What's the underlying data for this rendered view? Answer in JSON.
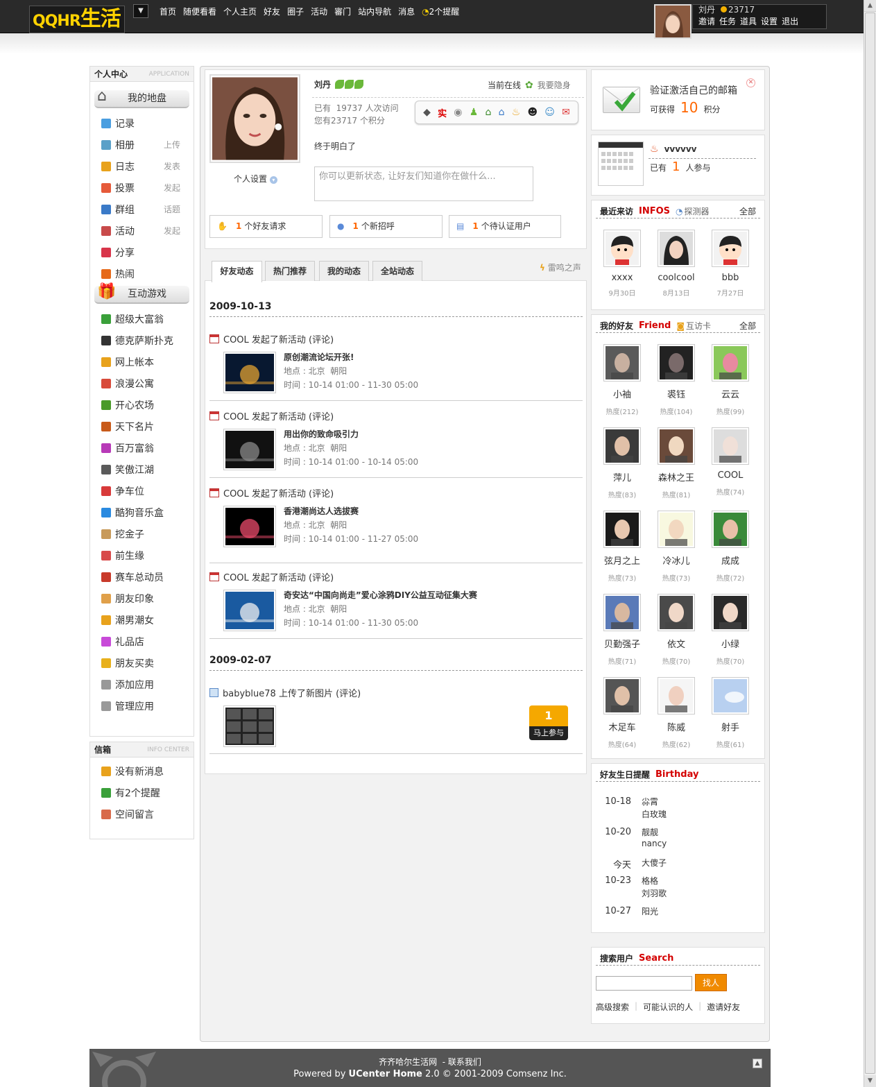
{
  "header": {
    "logo_main": "QQHR",
    "logo_cn": "生活",
    "nav": [
      "首页",
      "随便看看",
      "个人主页",
      "好友",
      "圈子",
      "活动",
      "審门",
      "站内导航",
      "消息",
      "2个提醒"
    ],
    "user_name": "刘丹",
    "user_coins": "23717",
    "user_links": [
      "邀请",
      "任务",
      "道具",
      "设置",
      "退出"
    ]
  },
  "left": {
    "panel_title": "个人中心",
    "panel_title_en": "APPLICATION",
    "section1": "我的地盘",
    "items1": [
      {
        "label": "记录",
        "action": "",
        "color": "#4a9ee0"
      },
      {
        "label": "相册",
        "action": "上传",
        "color": "#5aa0c8"
      },
      {
        "label": "日志",
        "action": "发表",
        "color": "#e8a21c"
      },
      {
        "label": "投票",
        "action": "发起",
        "color": "#e65a3a"
      },
      {
        "label": "群组",
        "action": "话题",
        "color": "#3a7ac8"
      },
      {
        "label": "活动",
        "action": "发起",
        "color": "#c84a4a"
      },
      {
        "label": "分享",
        "action": "",
        "color": "#d8354a"
      },
      {
        "label": "热闹",
        "action": "",
        "color": "#e66a1a"
      }
    ],
    "section2": "互动游戏",
    "items2": [
      {
        "label": "超级大富翁",
        "color": "#3aa03a"
      },
      {
        "label": "德克萨斯扑克",
        "color": "#333333"
      },
      {
        "label": "网上帐本",
        "color": "#e8a21c"
      },
      {
        "label": "浪漫公寓",
        "color": "#d84a3a"
      },
      {
        "label": "开心农场",
        "color": "#4a9a2a"
      },
      {
        "label": "天下名片",
        "color": "#c85a1a"
      },
      {
        "label": "百万富翁",
        "color": "#b83ab8"
      },
      {
        "label": "笑傲江湖",
        "color": "#5a5a5a"
      },
      {
        "label": "争车位",
        "color": "#d83a3a"
      },
      {
        "label": "酷狗音乐盒",
        "color": "#2a8ae0"
      },
      {
        "label": "挖金子",
        "color": "#c89a5a"
      },
      {
        "label": "前生缘",
        "color": "#d84a4a"
      },
      {
        "label": "赛车总动员",
        "color": "#c83a2a"
      },
      {
        "label": "朋友印象",
        "color": "#e0a04a"
      },
      {
        "label": "潮男潮女",
        "color": "#e8a21c"
      },
      {
        "label": "礼品店",
        "color": "#c84ad8"
      },
      {
        "label": "朋友买卖",
        "color": "#e8b01c"
      },
      {
        "label": "添加应用",
        "color": "#999999"
      },
      {
        "label": "管理应用",
        "color": "#999999"
      }
    ],
    "info_title": "信箱",
    "info_title_en": "INFO CENTER",
    "info_items": [
      {
        "label": "没有新消息",
        "color": "#e8a21c"
      },
      {
        "label": "有2个提醒",
        "color": "#3aa03a"
      },
      {
        "label": "空间留言",
        "color": "#d86a4a"
      }
    ]
  },
  "profile": {
    "name": "刘丹",
    "status_online": "当前在线",
    "hide_label": "我要隐身",
    "visits": "已有  19737 人次访问",
    "points": "您有23717 个积分",
    "mood": "终于明白了",
    "settings": "个人设置",
    "status_placeholder": "你可以更新状态, 让好友们知道你在做什么...",
    "notices": [
      {
        "count": "1",
        "label": "个好友请求"
      },
      {
        "count": "1",
        "label": "个新招呼"
      },
      {
        "count": "1",
        "label": "个待认证用户"
      }
    ]
  },
  "tabs": [
    "好友动态",
    "热门推荐",
    "我的动态",
    "全站动态"
  ],
  "tab_right": "雷鸣之声",
  "feeds": {
    "date1": "2009-10-13",
    "date2": "2009-02-07",
    "activities": [
      {
        "head": "COOL 发起了新活动 (评论)",
        "title": "原创潮流论坛开张!",
        "place": "地点 : 北京  朝阳",
        "time": "时间 : 10-14 01:00 - 11-30 05:00"
      },
      {
        "head": "COOL 发起了新活动 (评论)",
        "title": "用出你的致命吸引力",
        "place": "地点 : 北京  朝阳",
        "time": "时间 : 10-14 01:00 - 10-14 05:00"
      },
      {
        "head": "COOL 发起了新活动 (评论)",
        "title": "香港潮尚达人选拔赛",
        "place": "地点 : 北京  朝阳",
        "time": "时间 : 10-14 01:00 - 11-27 05:00"
      },
      {
        "head": "COOL 发起了新活动 (评论)",
        "title": "奇安达“中国向尚走”爱心涂鸦DIY公益互动征集大赛",
        "place": "地点 : 北京  朝阳",
        "time": "时间 : 10-14 01:00 - 11-30 05:00"
      }
    ],
    "upload_head": "babyblue78 上传了新图片 (评论)",
    "join_count": "1",
    "join_label": "马上参与"
  },
  "right": {
    "verify_title": "验证激活自己的邮箱",
    "verify_prefix": "可获得",
    "verify_points": "10",
    "verify_suffix": "积分",
    "event_name": "vvvvvv",
    "event_prefix": "已有",
    "event_count": "1",
    "event_suffix": "人参与",
    "visitors_title": "最近来访",
    "visitors_en": "INFOS",
    "visitors_tool": "探测器",
    "all": "全部",
    "visitors": [
      {
        "name": "xxxx",
        "date": "9月30日"
      },
      {
        "name": "coolcool",
        "date": "8月13日"
      },
      {
        "name": "bbb",
        "date": "7月27日"
      }
    ],
    "friends_title": "我的好友",
    "friends_en": "Friend",
    "friends_tool": "互访卡",
    "friends": [
      {
        "name": "小袖",
        "hot": "热度(212)"
      },
      {
        "name": "裘钰",
        "hot": "热度(104)"
      },
      {
        "name": "云云",
        "hot": "热度(99)"
      },
      {
        "name": "萍儿",
        "hot": "热度(83)"
      },
      {
        "name": "森林之王",
        "hot": "热度(81)"
      },
      {
        "name": "COOL",
        "hot": "热度(74)"
      },
      {
        "name": "弦月之上",
        "hot": "热度(73)"
      },
      {
        "name": "冷冰儿",
        "hot": "热度(73)"
      },
      {
        "name": "成成",
        "hot": "热度(72)"
      },
      {
        "name": "贝勤强子",
        "hot": "热度(71)"
      },
      {
        "name": "依文",
        "hot": "热度(70)"
      },
      {
        "name": "小绿",
        "hot": "热度(70)"
      },
      {
        "name": "木足车",
        "hot": "热度(64)"
      },
      {
        "name": "陈威",
        "hot": "热度(62)"
      },
      {
        "name": "射手",
        "hot": "热度(61)"
      }
    ],
    "birthday_title": "好友生日提醒",
    "birthday_en": "Birthday",
    "birthdays": [
      {
        "date": "10-18",
        "names": [
          "尛霄",
          "白玫瑰"
        ]
      },
      {
        "date": "10-20",
        "names": [
          "靓靓",
          "nancy"
        ]
      },
      {
        "date": "今天",
        "names": [
          "大傻子"
        ]
      },
      {
        "date": "10-23",
        "names": [
          "格格",
          "刘羽歌"
        ]
      },
      {
        "date": "10-27",
        "names": [
          "阳光"
        ]
      }
    ],
    "search_title": "搜索用户",
    "search_en": "Search",
    "search_button": "找人",
    "search_links": [
      "高级搜索",
      "可能认识的人",
      "邀请好友"
    ]
  },
  "footer": {
    "line1": "齐齐哈尔生活网  - 联系我们",
    "line2_prefix": "Powered by ",
    "line2_brand": "UCenter Home",
    "line2_suffix": " 2.0 © 2001-2009 Comsenz Inc."
  }
}
